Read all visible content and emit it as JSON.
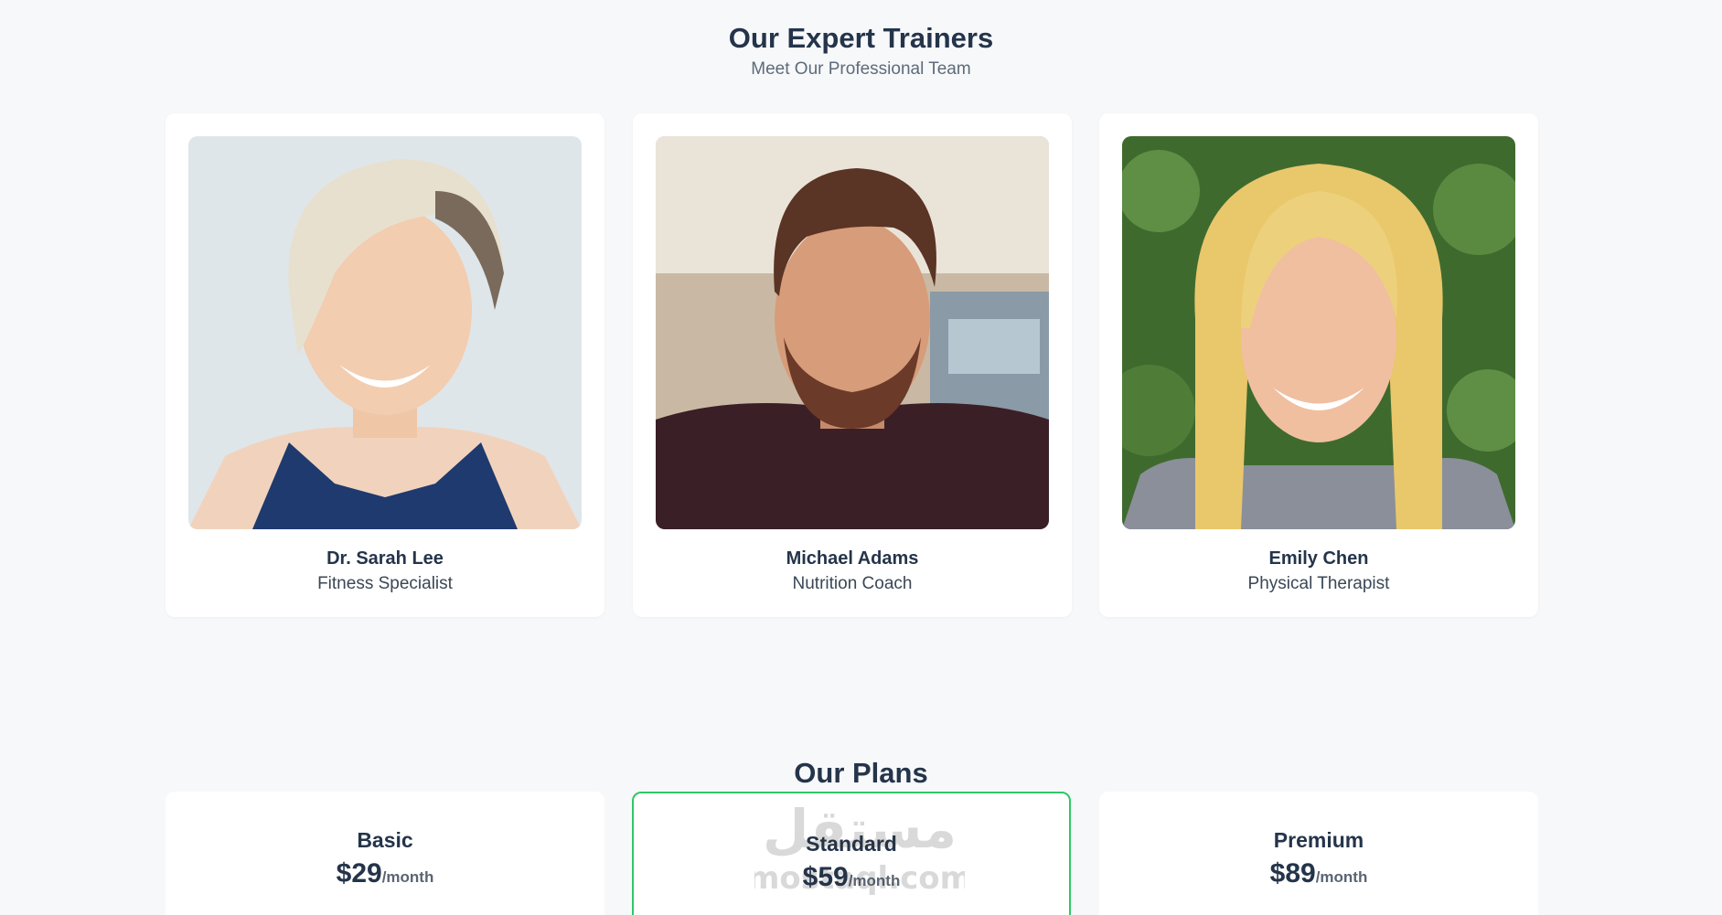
{
  "trainers": {
    "title": "Our Expert Trainers",
    "subtitle": "Meet Our Professional Team",
    "items": [
      {
        "name": "Dr. Sarah Lee",
        "role": "Fitness Specialist"
      },
      {
        "name": "Michael Adams",
        "role": "Nutrition Coach"
      },
      {
        "name": "Emily Chen",
        "role": "Physical Therapist"
      }
    ]
  },
  "plans": {
    "title": "Our Plans",
    "items": [
      {
        "name": "Basic",
        "price": "$29",
        "period": "/month"
      },
      {
        "name": "Standard",
        "price": "$59",
        "period": "/month"
      },
      {
        "name": "Premium",
        "price": "$89",
        "period": "/month"
      }
    ]
  },
  "watermark": {
    "arabic": "مستقل",
    "latin": "mostaql.com"
  },
  "colors": {
    "background": "#f7f8fa",
    "card": "#ffffff",
    "heading": "#24344a",
    "featured_border": "#2ec866"
  }
}
